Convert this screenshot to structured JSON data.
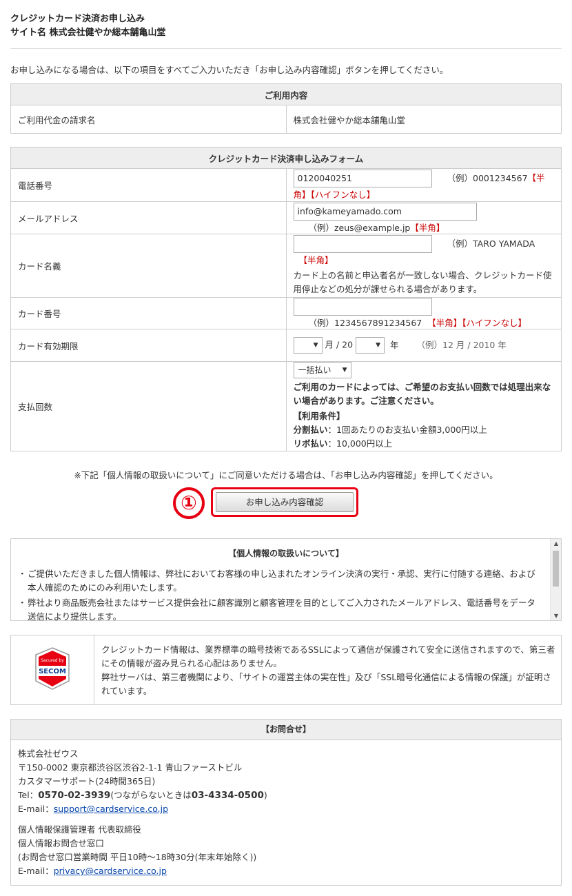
{
  "header": {
    "title": "クレジットカード決済お申し込み",
    "site_label": "サイト名 株式会社健やか総本舗亀山堂"
  },
  "intro": "お申し込みになる場合は、以下の項目をすべてご入力いただき「お申し込み内容確認」ボタンを押してください。",
  "usage": {
    "caption": "ご利用内容",
    "billing_label": "ご利用代金の請求名",
    "billing_value": "株式会社健やか総本舗亀山堂"
  },
  "form": {
    "caption": "クレジットカード決済申し込みフォーム",
    "phone": {
      "label": "電話番号",
      "value": "0120040251",
      "example": "（例）0001234567",
      "tag1": "【半角】",
      "tag2": "【ハイフンなし】"
    },
    "email": {
      "label": "メールアドレス",
      "value": "info@kameyamado.com",
      "example": "（例）zeus@example.jp",
      "tag1": "【半角】"
    },
    "card_name": {
      "label": "カード名義",
      "value": "",
      "example": "（例）TARO YAMADA",
      "tag1": "【半角】",
      "note": "カード上の名前と申込者名が一致しない場合、クレジットカード使用停止などの処分が課せられる場合があります。"
    },
    "card_number": {
      "label": "カード番号",
      "value": "",
      "example": "（例）1234567891234567",
      "tag1": "【半角】",
      "tag2": "【ハイフンなし】"
    },
    "expiry": {
      "label": "カード有効期限",
      "month_suffix": "月 / 20",
      "year_suffix": "年",
      "example": "（例）12 月 / 2010 年"
    },
    "payment": {
      "label": "支払回数",
      "selected": "一括払い",
      "warning": "ご利用のカードによっては、ご希望のお支払い回数では処理出来ない場合があります。ご注意ください。",
      "conditions_title": "【利用条件】",
      "installment_label": "分割払い",
      "installment_text": "：1回あたりのお支払い金額3,000円以上",
      "revolving_label": "リボ払い",
      "revolving_text": "：10,000円以上"
    }
  },
  "consent_text": "※下記「個人情報の取扱いについて」にご同意いただける場合は、「お申し込み内容確認」を押してください。",
  "step_marker": "①",
  "confirm_button": "お申し込み内容確認",
  "privacy": {
    "title": "【個人情報の取扱いについて】",
    "items": [
      "ご提供いただきました個人情報は、弊社においてお客様の申し込まれたオンライン決済の実行・承認、実行に付随する連絡、および本人確認のためにのみ利用いたします。",
      "弊社より商品販売会社またはサービス提供会社に顧客識別と顧客管理を目的としてご入力されたメールアドレス、電話番号をデータ送信により提供します。"
    ]
  },
  "ssl": {
    "logo_top": "Secured by",
    "logo_name": "SECOM",
    "line1": "クレジットカード情報は、業界標準の暗号技術であるSSLによって通信が保護されて安全に送信されますので、第三者にその情報が盗み見られる心配はありません。",
    "line2": "弊社サーバは、第三者機関により、「サイトの運営主体の実在性」及び「SSL暗号化通信による情報の保護」が証明されています。"
  },
  "contact": {
    "caption": "【お問合せ】",
    "company": "株式会社ゼウス",
    "address": "〒150-0002 東京都渋谷区渋谷2-1-1 青山ファーストビル",
    "support_hours": "カスタマーサポート(24時間365日)",
    "tel_prefix": "Tel：",
    "tel_main": "0570-02-3939",
    "tel_mid": "(つながらないときは",
    "tel_alt": "03-4334-0500",
    "tel_suffix": ")",
    "email_prefix": "E-mail：",
    "email": "support@cardservice.co.jp",
    "privacy_manager": "個人情報保護管理者 代表取締役",
    "privacy_desk": "個人情報お問合せ窓口",
    "privacy_hours": "(お問合せ窓口営業時間 平日10時～18時30分(年末年始除く))",
    "privacy_email_prefix": "E-mail：",
    "privacy_email": "privacy@cardservice.co.jp"
  },
  "colors": {
    "accent": "#e60012",
    "required": "#cc0000",
    "link": "#0645ad",
    "header_bg": "#eeeeee"
  }
}
